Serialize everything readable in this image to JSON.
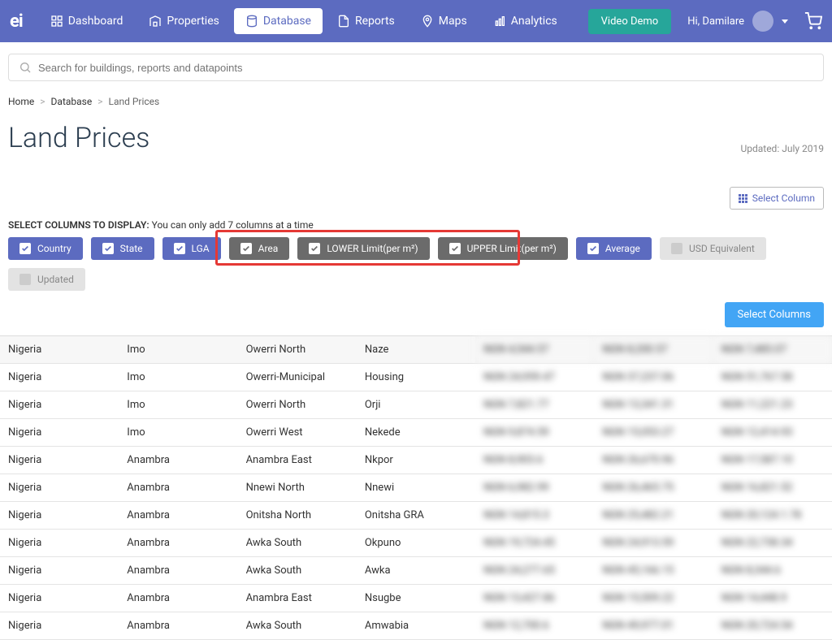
{
  "logo": "ei",
  "nav": {
    "dashboard": "Dashboard",
    "properties": "Properties",
    "database": "Database",
    "reports": "Reports",
    "maps": "Maps",
    "analytics": "Analytics"
  },
  "video_demo": "Video Demo",
  "user_greeting": "Hi,  Damilare",
  "search": {
    "placeholder": "Search for buildings, reports and datapoints"
  },
  "breadcrumb": {
    "home": "Home",
    "database": "Database",
    "land": "Land Prices"
  },
  "title": "Land Prices",
  "updated": "Updated: July 2019",
  "select_column_btn": "Select Column",
  "col_panel": {
    "label_strong": "SELECT COLUMNS TO DISPLAY:",
    "label_rest": " You can only add 7 columns at a time"
  },
  "chips": {
    "country": "Country",
    "state": "State",
    "lga": "LGA",
    "area": "Area",
    "lower": "LOWER Limit(per m²)",
    "upper": "UPPER Limit(per m²)",
    "average": "Average",
    "usd": "USD Equivalent",
    "updated": "Updated"
  },
  "select_columns": "Select Columns",
  "rows": [
    {
      "country": "Nigeria",
      "state": "Imo",
      "lga": "Owerri North",
      "area": "Naze",
      "v1": "NGN 4,544.57",
      "v2": "NGN 8,200.57",
      "v3": "NGN 7,485.07"
    },
    {
      "country": "Nigeria",
      "state": "Imo",
      "lga": "Owerri-Municipal",
      "area": "Housing",
      "v1": "NGN 24,959.47",
      "v2": "NGN 37,237.06",
      "v3": "NGN 51,767.58"
    },
    {
      "country": "Nigeria",
      "state": "Imo",
      "lga": "Owerri North",
      "area": "Orji",
      "v1": "NGN 7,821.77",
      "v2": "NGN 13,341.31",
      "v3": "NGN 11,221.23"
    },
    {
      "country": "Nigeria",
      "state": "Imo",
      "lga": "Owerri West",
      "area": "Nekede",
      "v1": "NGN 9,874.59",
      "v2": "NGN 15,053.27",
      "v3": "NGN 12,414.93"
    },
    {
      "country": "Nigeria",
      "state": "Anambra",
      "lga": "Anambra East",
      "area": "Nkpor",
      "v1": "NGN 8,903.6",
      "v2": "NGN 26,670.96",
      "v3": "NGN 17,587.10"
    },
    {
      "country": "Nigeria",
      "state": "Anambra",
      "lga": "Nnewi North",
      "area": "Nnewi",
      "v1": "NGN 6,982.99",
      "v2": "NGN 26,465.75",
      "v3": "NGN 16,821.52"
    },
    {
      "country": "Nigeria",
      "state": "Anambra",
      "lga": "Onitsha North",
      "area": "Onitsha GRA",
      "v1": "NGN 14,815.3",
      "v2": "NGN 25,482.21",
      "v3": "NGN 20,124.1.78"
    },
    {
      "country": "Nigeria",
      "state": "Anambra",
      "lga": "Awka South",
      "area": "Okpuno",
      "v1": "NGN 19,724.45",
      "v2": "NGN 24,913.59",
      "v3": "NGN 22,738.34"
    },
    {
      "country": "Nigeria",
      "state": "Anambra",
      "lga": "Awka South",
      "area": "Awka",
      "v1": "NGN 24,277.65",
      "v2": "NGN 45,166.15",
      "v3": "NGN 8,344.6"
    },
    {
      "country": "Nigeria",
      "state": "Anambra",
      "lga": "Anambra East",
      "area": "Nsugbe",
      "v1": "NGN 13,427.86",
      "v2": "NGN 15,509.22",
      "v3": "NGN 14,448.9"
    },
    {
      "country": "Nigeria",
      "state": "Anambra",
      "lga": "Awka South",
      "area": "Amwabia",
      "v1": "NGN 12,700.6",
      "v2": "NGN 49,977.01",
      "v3": "NGN 20,724.54"
    }
  ]
}
